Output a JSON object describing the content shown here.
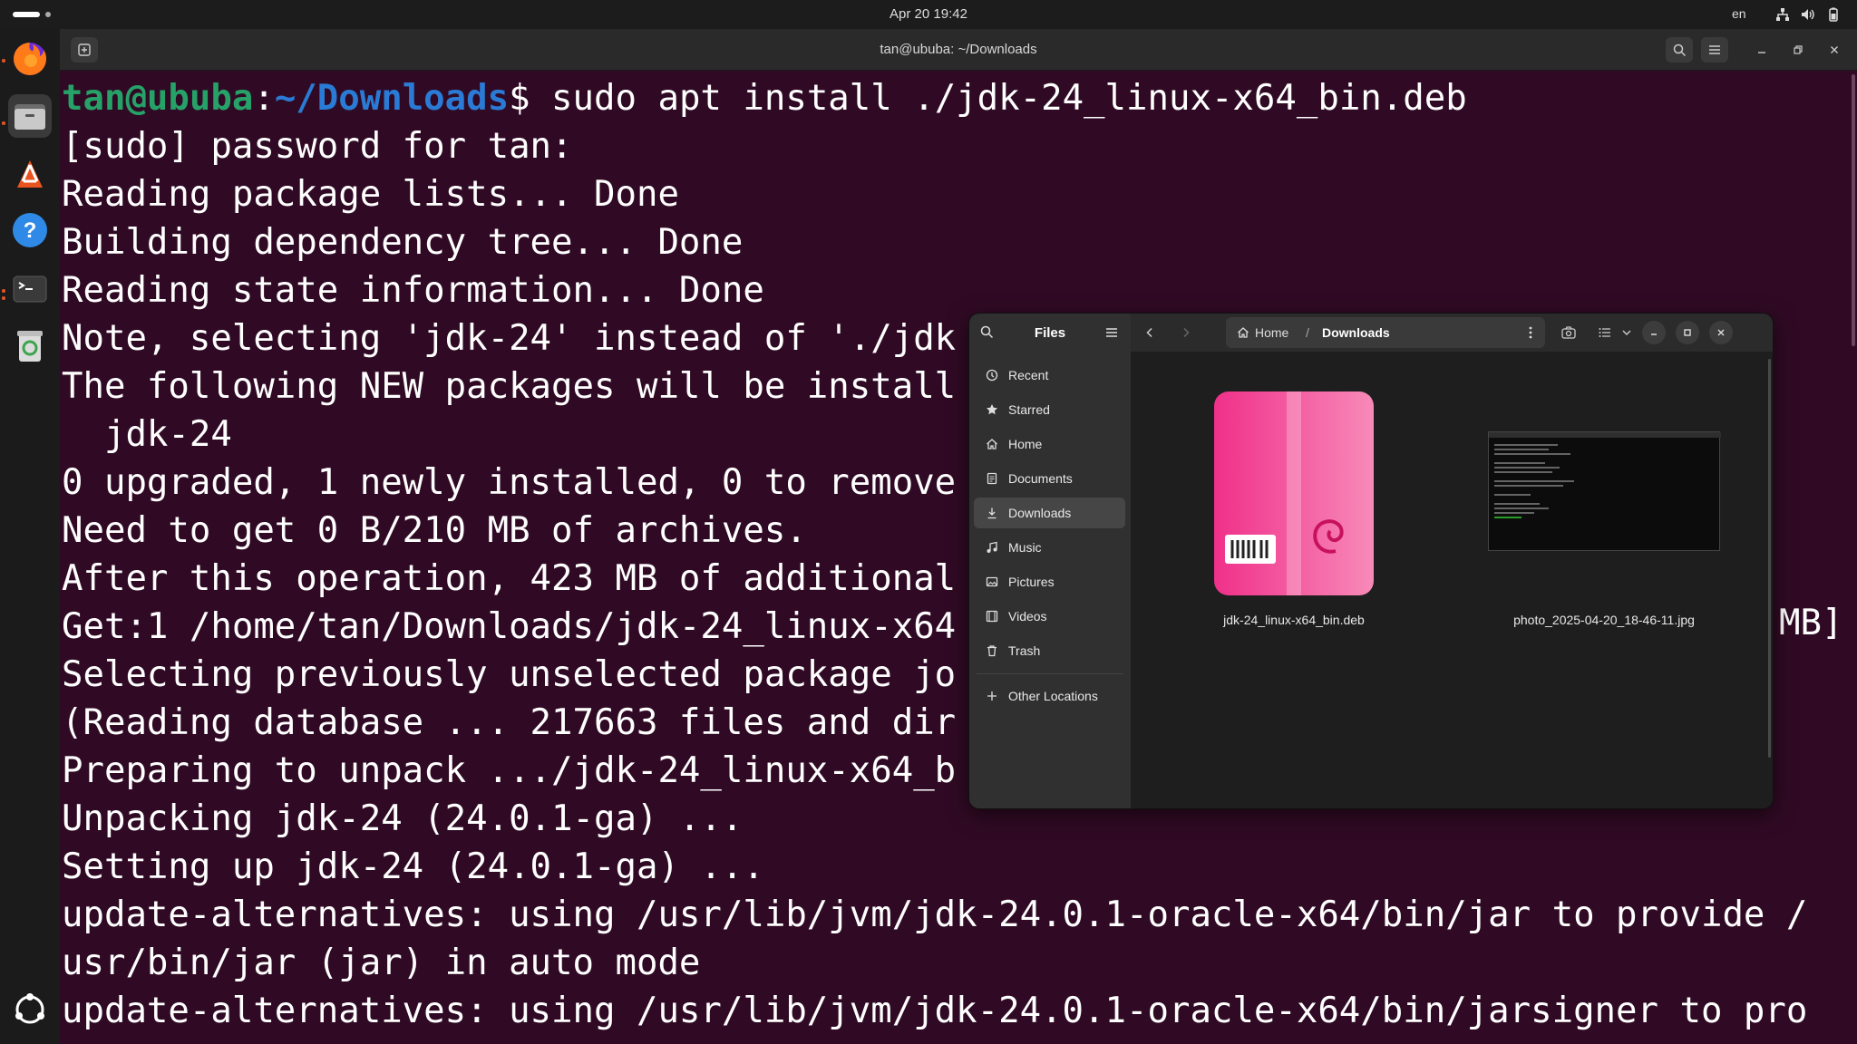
{
  "topbar": {
    "clock": "Apr 20  19:42",
    "language": "en",
    "icons": [
      "network-icon",
      "volume-icon",
      "battery-icon"
    ]
  },
  "dock": {
    "apps": [
      {
        "name": "Firefox",
        "icon": "firefox-icon",
        "running": true
      },
      {
        "name": "Files",
        "icon": "files-icon",
        "running": true,
        "active": true
      },
      {
        "name": "App Center",
        "icon": "app-center-icon",
        "running": false
      },
      {
        "name": "Help",
        "icon": "help-icon",
        "running": false
      },
      {
        "name": "Terminal",
        "icon": "terminal-icon",
        "running": true
      },
      {
        "name": "Trash",
        "icon": "trash-icon",
        "running": false
      }
    ],
    "show_apps_icon": "show-apps-icon"
  },
  "terminal": {
    "title": "tan@ububa: ~/Downloads",
    "prompt_user": "tan@ububa",
    "prompt_sep": ":",
    "prompt_path": "~/Downloads",
    "prompt_dollar": "$",
    "command": " sudo apt install ./jdk-24_linux-x64_bin.deb",
    "lines": [
      "[sudo] password for tan:",
      "Reading package lists... Done",
      "Building dependency tree... Done",
      "Reading state information... Done",
      "Note, selecting 'jdk-24' instead of './jdk",
      "The following NEW packages will be install",
      "  jdk-24",
      "0 upgraded, 1 newly installed, 0 to remove",
      "Need to get 0 B/210 MB of archives.",
      "After this operation, 423 MB of additional",
      "Get:1 /home/tan/Downloads/jdk-24_linux-x64",
      "Selecting previously unselected package jo",
      "(Reading database ... 217663 files and dir",
      "Preparing to unpack .../jdk-24_linux-x64_b",
      "Unpacking jdk-24 (24.0.1-ga) ...",
      "Setting up jdk-24 (24.0.1-ga) ...",
      "update-alternatives: using /usr/lib/jvm/jdk-24.0.1-oracle-x64/bin/jar to provide /",
      "usr/bin/jar (jar) in auto mode",
      "update-alternatives: using /usr/lib/jvm/jdk-24.0.1-oracle-x64/bin/jarsigner to pro"
    ],
    "right_fragment": "MB]"
  },
  "files": {
    "title": "Files",
    "sidebar": [
      {
        "label": "Recent",
        "icon": "clock-icon"
      },
      {
        "label": "Starred",
        "icon": "star-icon"
      },
      {
        "label": "Home",
        "icon": "home-icon"
      },
      {
        "label": "Documents",
        "icon": "document-icon"
      },
      {
        "label": "Downloads",
        "icon": "download-icon",
        "selected": true
      },
      {
        "label": "Music",
        "icon": "music-icon"
      },
      {
        "label": "Pictures",
        "icon": "picture-icon"
      },
      {
        "label": "Videos",
        "icon": "video-icon"
      },
      {
        "label": "Trash",
        "icon": "trash-icon"
      }
    ],
    "other_locations": "Other Locations",
    "path": {
      "home": "Home",
      "separator": "/",
      "current": "Downloads"
    },
    "items": [
      {
        "name": "jdk-24_linux-x64_bin.deb",
        "type": "deb-package-icon"
      },
      {
        "name": "photo_2025-04-20_18-46-11.jpg",
        "type": "image-thumbnail"
      }
    ]
  }
}
